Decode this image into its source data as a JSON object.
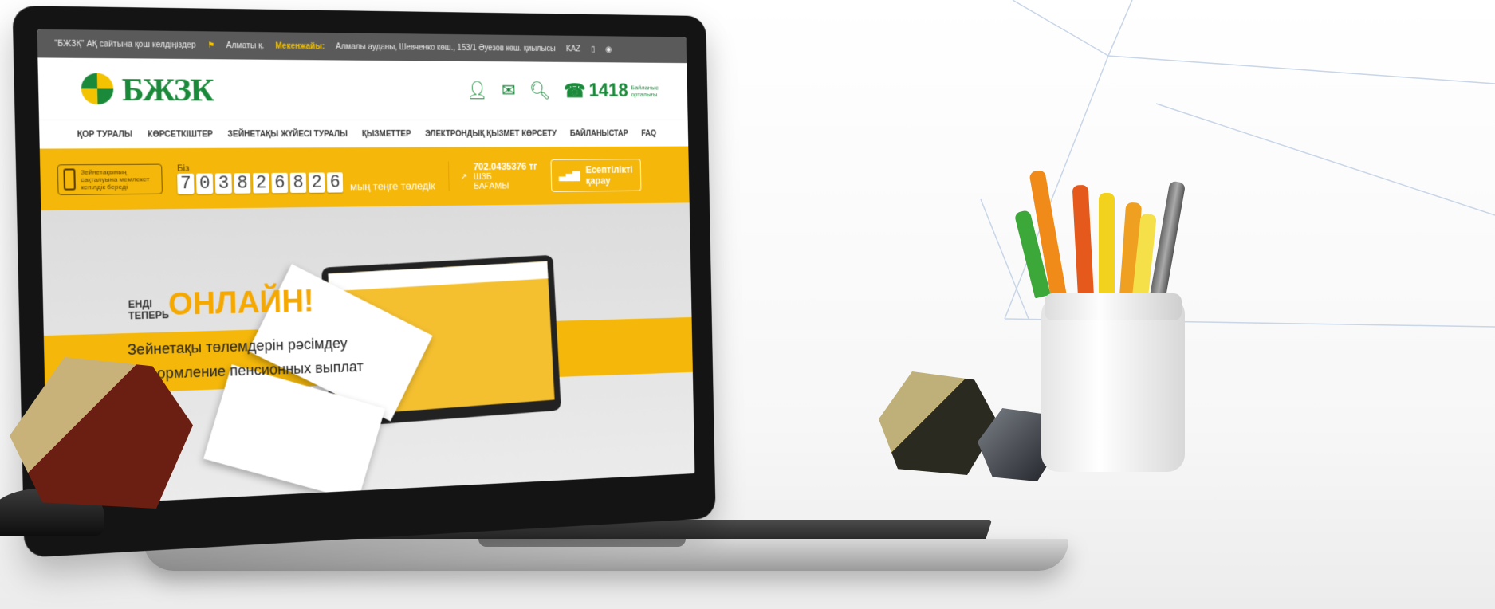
{
  "site": {
    "topbar": {
      "welcome": "\"БЖЗҚ\" АҚ сайтына қош келдіңіздер",
      "city": "Алматы қ.",
      "address_label": "Мекенжайы:",
      "address": "Алмалы ауданы, Шевченко көш., 153/1 Әуезов көш. қиылысы",
      "language": "KAZ"
    },
    "header": {
      "logo": "БЖЗК",
      "phone_number": "1418",
      "phone_caption_1": "Байланыс",
      "phone_caption_2": "орталығы"
    },
    "nav": [
      "ҚОР ТУРАЛЫ",
      "КӨРСЕТКІШТЕР",
      "ЗЕЙНЕТАҚЫ ЖҮЙЕСІ ТУРАЛЫ",
      "ҚЫЗМЕТТЕР",
      "ЭЛЕКТРОНДЫҚ ҚЫЗМЕТ КӨРСЕТУ",
      "БАЙЛАНЫСТАР",
      "FAQ"
    ],
    "banner": {
      "guarantee_text": "Зейнетақының сақталуына мемлекет кепілдік береді",
      "we_pay_label": "Біз",
      "digits": [
        "7",
        "0",
        "3",
        "8",
        "2",
        "6",
        "8",
        "2",
        "6"
      ],
      "counter_suffix": "мың теңге төледік",
      "rate_value": "702.0435376 тг",
      "rate_label_1": "ШЗБ",
      "rate_label_2": "БАҒАМЫ",
      "report_line_1": "Есептілікті",
      "report_line_2": "қарау"
    },
    "hero": {
      "small_1": "ЕНДІ",
      "small_2": "ТЕПЕРЬ",
      "big": "ОНЛАЙН!",
      "line_kz": "Зейнетақы төлемдерін рәсімдеу",
      "line_ru": "Оформление пенсионных выплат"
    }
  },
  "colors": {
    "brand_green": "#1a8a3a",
    "brand_yellow": "#f5b80a",
    "topbar_gray": "#5a5a5a"
  },
  "icons": [
    "location-pin-icon",
    "user-icon",
    "mail-icon",
    "search-icon",
    "phone-icon",
    "eye-icon",
    "mobile-icon",
    "safe-icon",
    "chart-icon"
  ]
}
